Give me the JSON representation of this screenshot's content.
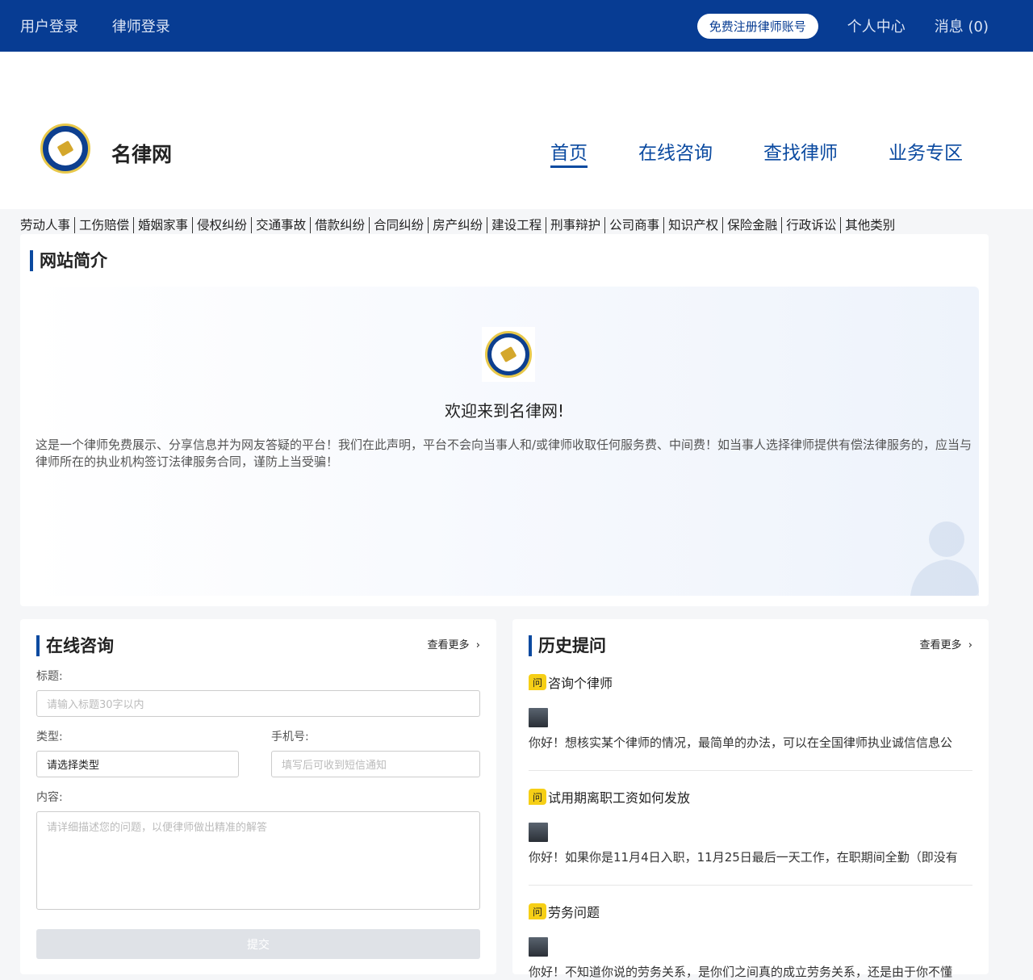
{
  "topbar": {
    "user_login": "用户登录",
    "lawyer_login": "律师登录",
    "register": "免费注册律师账号",
    "personal": "个人中心",
    "messages": "消息 (0)"
  },
  "header": {
    "brand": "名律网",
    "nav": [
      "首页",
      "在线咨询",
      "查找律师",
      "业务专区"
    ]
  },
  "categories": [
    "劳动人事",
    "工伤赔偿",
    "婚姻家事",
    "侵权纠纷",
    "交通事故",
    "借款纠纷",
    "合同纠纷",
    "房产纠纷",
    "建设工程",
    "刑事辩护",
    "公司商事",
    "知识产权",
    "保险金融",
    "行政诉讼",
    "其他类别"
  ],
  "intro": {
    "title": "网站简介",
    "welcome": "欢迎来到名律网!",
    "desc": "这是一个律师免费展示、分享信息并为网友答疑的平台！我们在此声明，平台不会向当事人和/或律师收取任何服务费、中间费！如当事人选择律师提供有偿法律服务的，应当与律师所在的执业机构签订法律服务合同，谨防上当受骗！"
  },
  "consult": {
    "title": "在线咨询",
    "more": "查看更多",
    "title_label": "标题:",
    "title_placeholder": "请输入标题30字以内",
    "type_label": "类型:",
    "type_value": "请选择类型",
    "phone_label": "手机号:",
    "phone_placeholder": "填写后可收到短信通知",
    "content_label": "内容:",
    "content_placeholder": "请详细描述您的问题，以便律师做出精准的解答",
    "submit": "提交"
  },
  "history": {
    "title": "历史提问",
    "more": "查看更多",
    "badge": "问",
    "items": [
      {
        "q": "咨询个律师",
        "a": "你好！想核实某个律师的情况，最简单的办法，可以在全国律师执业诚信信息公"
      },
      {
        "q": "试用期离职工资如何发放",
        "a": "你好！如果你是11月4日入职，11月25日最后一天工作，在职期间全勤（即没有"
      },
      {
        "q": "劳务问题",
        "a": "你好！不知道你说的劳务关系，是你们之间真的成立劳务关系，还是由于你不懂"
      }
    ]
  }
}
